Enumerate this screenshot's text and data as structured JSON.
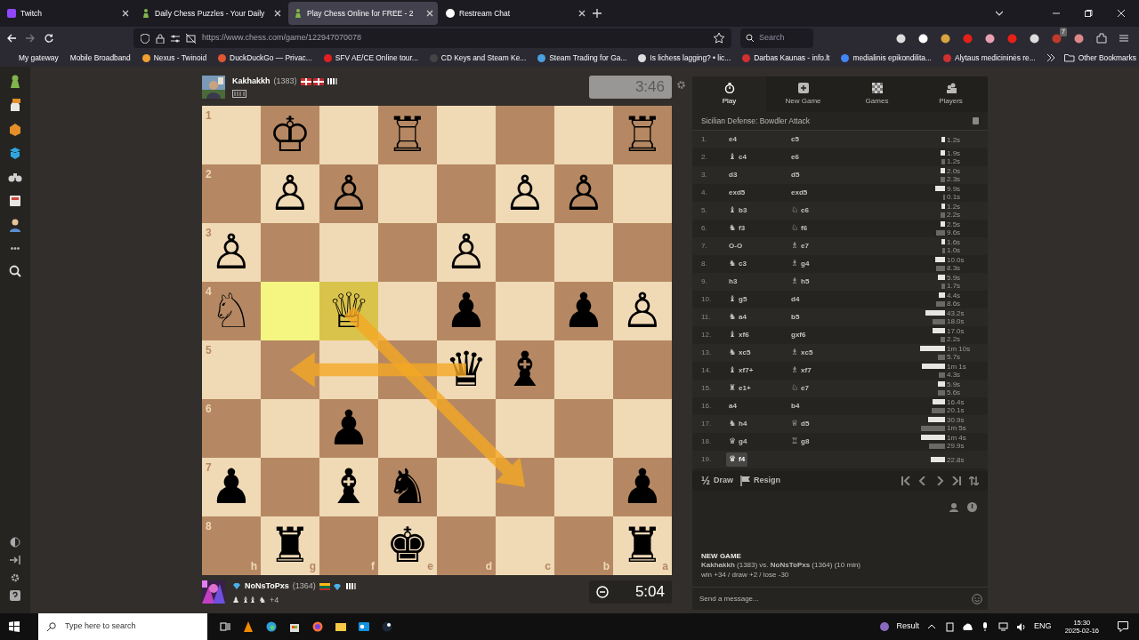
{
  "browser": {
    "tabs": [
      {
        "title": "Twitch",
        "selected": false
      },
      {
        "title": "Daily Chess Puzzles - Your Daily",
        "selected": false
      },
      {
        "title": "Play Chess Online for FREE - 2",
        "selected": true
      },
      {
        "title": "Restream Chat",
        "selected": false
      }
    ],
    "url": "https://www.chess.com/game/122947070078",
    "search": {
      "placeholder": "Search"
    },
    "extension_badge": "7",
    "bookmarks": [
      {
        "label": "My gateway"
      },
      {
        "label": "Mobile Broadband"
      },
      {
        "label": "Nexus - Twinoid",
        "color": "#f0a030"
      },
      {
        "label": "DuckDuckGo — Privac...",
        "color": "#de5833"
      },
      {
        "label": "SFV AE/CE Online tour...",
        "color": "#e02020"
      },
      {
        "label": "CD Keys and Steam Ke...",
        "color": "#444444"
      },
      {
        "label": "Steam Trading for Ga...",
        "color": "#4aa0e0"
      },
      {
        "label": "Is lichess lagging? • lic...",
        "color": "#dddddd"
      },
      {
        "label": "Darbas Kaunas - info.lt",
        "color": "#d03030"
      },
      {
        "label": "medialinis epikondilita...",
        "color": "#4285f4"
      },
      {
        "label": "Alytaus medicininės re...",
        "color": "#d03030"
      }
    ],
    "other_bookmarks": "Other Bookmarks"
  },
  "sidebar": {
    "more": "•••"
  },
  "top_player": {
    "name": "Kakhakkh",
    "rating": "(1383)",
    "clock": "3:46",
    "active": false
  },
  "bottom_player": {
    "name": "NoNsToPxs",
    "rating": "(1364)",
    "captured": "♟ ♝♝ ♞",
    "material": "+4",
    "clock": "5:04",
    "active": true
  },
  "board": {
    "rank_labels": [
      "1",
      "2",
      "3",
      "4",
      "5",
      "6",
      "7",
      "8"
    ],
    "file_labels": [
      "h",
      "g",
      "f",
      "e",
      "d",
      "c",
      "b",
      "a"
    ],
    "ranks": [
      [
        {
          "highlighted": false
        },
        {
          "piece": "♔",
          "highlighted": false
        },
        {
          "highlighted": false
        },
        {
          "piece": "♖",
          "highlighted": false
        },
        {
          "highlighted": false
        },
        {
          "highlighted": false
        },
        {
          "highlighted": false
        },
        {
          "piece": "♖",
          "highlighted": false
        }
      ],
      [
        {
          "highlighted": false
        },
        {
          "piece": "♙",
          "highlighted": false
        },
        {
          "piece": "♙",
          "highlighted": false
        },
        {
          "highlighted": false
        },
        {
          "highlighted": false
        },
        {
          "piece": "♙",
          "highlighted": false
        },
        {
          "piece": "♙",
          "highlighted": false
        },
        {
          "highlighted": false
        }
      ],
      [
        {
          "piece": "♙",
          "highlighted": false
        },
        {
          "highlighted": false
        },
        {
          "highlighted": false
        },
        {
          "highlighted": false
        },
        {
          "piece": "♙",
          "highlighted": false
        },
        {
          "highlighted": false
        },
        {
          "highlighted": false
        },
        {
          "highlighted": false
        }
      ],
      [
        {
          "piece": "♘",
          "highlighted": false
        },
        {
          "highlighted": true
        },
        {
          "piece": "♕",
          "highlighted": true
        },
        {
          "highlighted": false
        },
        {
          "piece": "♟",
          "highlighted": false
        },
        {
          "highlighted": false
        },
        {
          "piece": "♟",
          "highlighted": false
        },
        {
          "piece": "♙",
          "highlighted": false
        }
      ],
      [
        {
          "highlighted": false
        },
        {
          "highlighted": false
        },
        {
          "highlighted": false
        },
        {
          "highlighted": false
        },
        {
          "piece": "♛",
          "highlighted": false
        },
        {
          "piece": "♝",
          "highlighted": false
        },
        {
          "highlighted": false
        },
        {
          "highlighted": false
        }
      ],
      [
        {
          "highlighted": false
        },
        {
          "highlighted": false
        },
        {
          "piece": "♟",
          "highlighted": false
        },
        {
          "highlighted": false
        },
        {
          "highlighted": false
        },
        {
          "highlighted": false
        },
        {
          "highlighted": false
        },
        {
          "highlighted": false
        }
      ],
      [
        {
          "piece": "♟",
          "highlighted": false
        },
        {
          "highlighted": false
        },
        {
          "piece": "♝",
          "highlighted": false
        },
        {
          "piece": "♞",
          "highlighted": false
        },
        {
          "highlighted": false
        },
        {
          "highlighted": false
        },
        {
          "highlighted": false
        },
        {
          "piece": "♟",
          "highlighted": false
        }
      ],
      [
        {
          "highlighted": false
        },
        {
          "piece": "♜",
          "highlighted": false
        },
        {
          "highlighted": false
        },
        {
          "piece": "♚",
          "highlighted": false
        },
        {
          "highlighted": false
        },
        {
          "highlighted": false
        },
        {
          "highlighted": false
        },
        {
          "piece": "♜",
          "highlighted": false
        }
      ]
    ]
  },
  "panel": {
    "tabs": [
      {
        "label": "Play",
        "selected": true
      },
      {
        "label": "New Game",
        "selected": false
      },
      {
        "label": "Games",
        "selected": false
      },
      {
        "label": "Players",
        "selected": false
      }
    ],
    "opening": "Sicilian Defense: Bowdler Attack",
    "moves": [
      {
        "number": "1.",
        "white": {
          "san": "e4",
          "selected": false
        },
        "black": {
          "san": "c5",
          "selected": false
        },
        "times": [
          "1.2s"
        ]
      },
      {
        "number": "2.",
        "white": {
          "piece": "♝",
          "san": "c4",
          "selected": false
        },
        "black": {
          "san": "e6",
          "selected": false
        },
        "times": [
          "1.9s",
          "1.2s"
        ]
      },
      {
        "number": "3.",
        "white": {
          "san": "d3",
          "selected": false
        },
        "black": {
          "san": "d5",
          "selected": false
        },
        "times": [
          "2.0s",
          "2.3s"
        ]
      },
      {
        "number": "4.",
        "white": {
          "san": "exd5",
          "selected": false
        },
        "black": {
          "san": "exd5",
          "selected": false
        },
        "times": [
          "9.9s",
          "0.1s"
        ]
      },
      {
        "number": "5.",
        "white": {
          "piece": "♝",
          "san": "b3",
          "selected": false
        },
        "black": {
          "piece": "♘",
          "san": "c6",
          "selected": false
        },
        "times": [
          "1.2s",
          "2.2s"
        ]
      },
      {
        "number": "6.",
        "white": {
          "piece": "♞",
          "san": "f3",
          "selected": false
        },
        "black": {
          "piece": "♘",
          "san": "f6",
          "selected": false
        },
        "times": [
          "2.5s",
          "9.6s"
        ]
      },
      {
        "number": "7.",
        "white": {
          "san": "O-O",
          "selected": false
        },
        "black": {
          "piece": "♗",
          "san": "e7",
          "selected": false
        },
        "times": [
          "1.6s",
          "1.0s"
        ]
      },
      {
        "number": "8.",
        "white": {
          "piece": "♞",
          "san": "c3",
          "selected": false
        },
        "black": {
          "piece": "♗",
          "san": "g4",
          "selected": false
        },
        "times": [
          "10.0s",
          "8.3s"
        ]
      },
      {
        "number": "9.",
        "white": {
          "san": "h3",
          "selected": false
        },
        "black": {
          "piece": "♗",
          "san": "h5",
          "selected": false
        },
        "times": [
          "5.9s",
          "1.7s"
        ]
      },
      {
        "number": "10.",
        "white": {
          "piece": "♝",
          "san": "g5",
          "selected": false
        },
        "black": {
          "san": "d4",
          "selected": false
        },
        "times": [
          "4.4s",
          "8.6s"
        ]
      },
      {
        "number": "11.",
        "white": {
          "piece": "♞",
          "san": "a4",
          "selected": false
        },
        "black": {
          "san": "b5",
          "selected": false
        },
        "times": [
          "43.2s",
          "18.0s"
        ]
      },
      {
        "number": "12.",
        "white": {
          "piece": "♝",
          "san": "xf6",
          "selected": false
        },
        "black": {
          "san": "gxf6",
          "selected": false
        },
        "times": [
          "17.0s",
          "2.2s"
        ]
      },
      {
        "number": "13.",
        "white": {
          "piece": "♞",
          "san": "xc5",
          "selected": false
        },
        "black": {
          "piece": "♗",
          "san": "xc5",
          "selected": false
        },
        "times": [
          "1m 10s",
          "5.7s"
        ]
      },
      {
        "number": "14.",
        "white": {
          "piece": "♝",
          "san": "xf7+",
          "selected": false
        },
        "black": {
          "piece": "♗",
          "san": "xf7",
          "selected": false
        },
        "times": [
          "1m 1s",
          "4.3s"
        ]
      },
      {
        "number": "15.",
        "white": {
          "piece": "♜",
          "san": "e1+",
          "selected": false
        },
        "black": {
          "piece": "♘",
          "san": "e7",
          "selected": false
        },
        "times": [
          "5.9s",
          "5.6s"
        ]
      },
      {
        "number": "16.",
        "white": {
          "san": "a4",
          "selected": false
        },
        "black": {
          "san": "b4",
          "selected": false
        },
        "times": [
          "16.4s",
          "20.1s"
        ]
      },
      {
        "number": "17.",
        "white": {
          "piece": "♞",
          "san": "h4",
          "selected": false
        },
        "black": {
          "piece": "♕",
          "san": "d5",
          "selected": false
        },
        "times": [
          "30.9s",
          "1m 5s"
        ]
      },
      {
        "number": "18.",
        "white": {
          "piece": "♛",
          "san": "g4",
          "selected": false
        },
        "black": {
          "piece": "♖",
          "san": "g8",
          "selected": false
        },
        "times": [
          "1m 4s",
          "29.9s"
        ]
      },
      {
        "number": "19.",
        "white": {
          "piece": "♛",
          "san": "f4",
          "selected": true
        },
        "times": [
          "22.8s"
        ]
      }
    ],
    "draw": {
      "icon": "½",
      "label": "Draw"
    },
    "resign": {
      "label": "Resign"
    },
    "game_info": {
      "title": "NEW GAME",
      "players": "**Kakhakkh** (1383) vs. **NoNsToPxs** (1364) (10 min)",
      "stakes": "win +34 / draw +2 / lose -30"
    },
    "chat": {
      "placeholder": "Send a message..."
    }
  },
  "taskbar": {
    "search_placeholder": "Type here to search",
    "weather": "Result",
    "language": "ENG",
    "time": "15:30",
    "date": "2025-02-16"
  }
}
